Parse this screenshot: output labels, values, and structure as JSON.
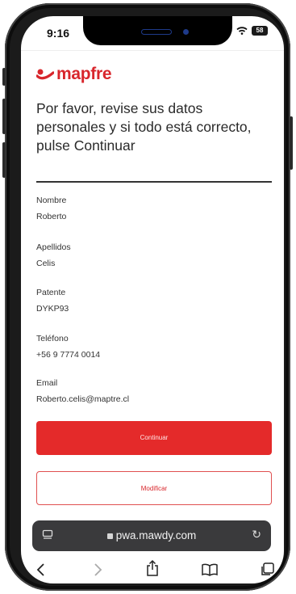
{
  "status_bar": {
    "time": "9:16",
    "battery": "58"
  },
  "brand": {
    "name": "mapfre",
    "color": "#d8262c"
  },
  "page": {
    "title": "Por favor, revise sus datos personales y si todo está correcto, pulse Continuar"
  },
  "fields": [
    {
      "label": "Nombre",
      "value": "Roberto"
    },
    {
      "label": "Apellidos",
      "value": "Celis"
    },
    {
      "label": "Patente",
      "value": "DYKP93"
    },
    {
      "label": "Teléfono",
      "value": "+56 9 7774 0014"
    },
    {
      "label": "Email",
      "value": "Roberto.celis@maptre.cl"
    }
  ],
  "actions": {
    "continue_label": "Continuar",
    "modify_label": "Modificar"
  },
  "browser": {
    "url": "pwa.mawdy.com"
  },
  "icons": {
    "tabs": "tabs-icon",
    "lock": "lock-icon",
    "reload": "reload-icon",
    "back": "back-icon",
    "forward": "forward-icon",
    "share": "share-icon",
    "bookmarks": "bookmarks-icon",
    "tab_overview": "tab-overview-icon"
  }
}
